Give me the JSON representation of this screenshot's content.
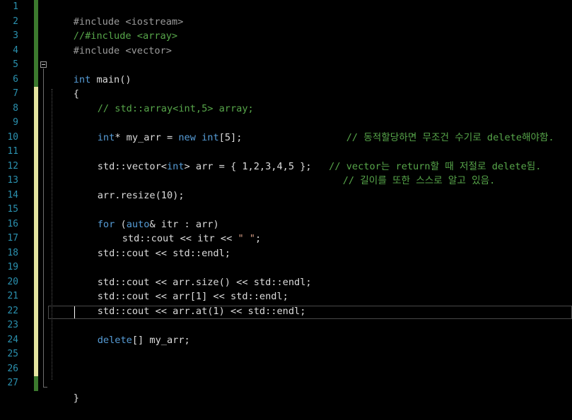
{
  "editor": {
    "line_numbers": [
      "1",
      "2",
      "3",
      "4",
      "5",
      "6",
      "7",
      "8",
      "9",
      "10",
      "11",
      "12",
      "13",
      "14",
      "15",
      "16",
      "17",
      "18",
      "19",
      "20",
      "21",
      "22",
      "23",
      "24",
      "25",
      "26",
      "27"
    ],
    "change_markers": [
      "green",
      "green",
      "green",
      "green",
      "green",
      "green",
      "yellow",
      "yellow",
      "yellow",
      "yellow",
      "yellow",
      "yellow",
      "yellow",
      "yellow",
      "yellow",
      "yellow",
      "yellow",
      "yellow",
      "yellow",
      "yellow",
      "yellow",
      "yellow",
      "yellow",
      "yellow",
      "yellow",
      "yellow",
      "green"
    ],
    "colors": {
      "background": "#000000",
      "line_number": "#2b91af",
      "marker_green": "#3c7a2e",
      "marker_yellow": "#e5e5a0",
      "keyword": "#569cd6",
      "comment": "#57a64a",
      "text": "#dcdcdc"
    },
    "lines": {
      "l1": "#include <iostream>",
      "l2": "//#include <array>",
      "l3": "#include <vector>",
      "l5_kw": "int",
      "l5_rest": " main()",
      "l6": "{",
      "l7": "// std::array<int,5> array;",
      "l9_kw1": "int",
      "l9_a": "* my_arr = ",
      "l9_kw2": "new",
      "l9_sp": " ",
      "l9_kw3": "int",
      "l9_b": "[5];",
      "l9_pad": "                  ",
      "l9_cm": "// 동적할당하면 무조건 수기로 delete해야함.",
      "l11_a": "std::vector<",
      "l11_kw": "int",
      "l11_b": "> arr = { 1,2,3,4,5 };",
      "l11_pad": "   ",
      "l11_cm": "// vector는 return할 때 저절로 delete됨.",
      "l12_cm": "// 길이를 또한 스스로 알고 있음.",
      "l13": "arr.resize(10);",
      "l15_kw1": "for",
      "l15_a": " (",
      "l15_kw2": "auto",
      "l15_b": "& itr : arr)",
      "l16_a": "std::cout << itr << ",
      "l16_str": "\" \"",
      "l16_b": ";",
      "l17": "std::cout << std::endl;",
      "l19": "std::cout << arr.size() << std::endl;",
      "l20": "std::cout << arr[1] << std::endl;",
      "l21": "std::cout << arr.at(1) << std::endl;",
      "l23_kw": "delete",
      "l23_b": "[] my_arr;",
      "l27": "}"
    }
  }
}
